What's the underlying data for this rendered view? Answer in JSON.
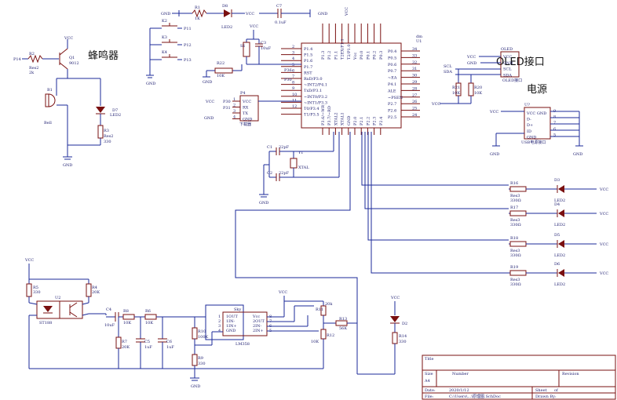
{
  "headings": {
    "buzzer": "蜂鸣器",
    "oled": "OLED接口",
    "power": "电源"
  },
  "nets": {
    "vcc": "VCC",
    "gnd": "GND"
  },
  "mcu": {
    "ref": "U1",
    "left_pins": [
      "P1.4",
      "P1.5",
      "P1.6",
      "P1.7",
      "RST",
      "RxD/P3.0",
      "~INT2/P4.1",
      "TxD/P3.1",
      "~INT0/P3.2",
      "~INT1/P3.3",
      "T0/P3.4",
      "T1/P3.5"
    ],
    "left_nums": [
      "2",
      "3",
      "4",
      "5",
      "6",
      "7",
      "8",
      "9",
      "10",
      "11",
      "12"
    ],
    "right_pins": [
      "P0.4",
      "P0.5",
      "P0.6",
      "P0.7",
      "~EA",
      "P4.1",
      "ALE",
      "~PSEN",
      "P2.7",
      "P2.6",
      "P2.5"
    ],
    "right_nums": [
      "34",
      "33",
      "32",
      "31",
      "30",
      "29",
      "28",
      "27",
      "26",
      "25",
      "24"
    ],
    "top_pins": [
      "P1.3",
      "P1.2",
      "P1.1",
      "T2EX/P1.1",
      "T2/P1.0",
      "Vcc",
      "P0.0",
      "P0.1",
      "P0.2",
      "P0.3"
    ],
    "bottom_pins": [
      "P3.6/~WR",
      "P3.7/~RD",
      "XTAL2",
      "XTAL1",
      "GND",
      "P2.0",
      "P2.1",
      "P2.2",
      "P2.3",
      "P2.4"
    ]
  },
  "parts": {
    "r1": "R1",
    "r1v": "1K",
    "d8": "D8",
    "d8v": "LED2",
    "c7": "C7",
    "c7v": "0.1uF",
    "k2": "K2",
    "k3": "K3",
    "k4": "K4",
    "p11": "P11",
    "p12": "P12",
    "p13": "P13",
    "p14": "P14",
    "r2": "R2",
    "r2t": "Res2",
    "r2v": "2k",
    "q1": "Q1",
    "q1v": "9012",
    "b1": "B1",
    "b1v": "Bell",
    "d7": "D7",
    "d7v": "LED2",
    "r3": "R3",
    "r3t": "Res2",
    "r3v": "330",
    "c3": "C3",
    "c3v": "10uF",
    "s1": "S1",
    "r22": "R22",
    "r22v": "10K",
    "p36": "P36",
    "p30": "P30",
    "p31": "P31",
    "p4": "P4",
    "p4t": "下载器",
    "p4pins": [
      "VCC",
      "RX",
      "TX",
      "GND"
    ],
    "p4nums": [
      "1",
      "2",
      "3",
      "4"
    ],
    "c1": "C1",
    "c1v": "22pF",
    "c2": "C2",
    "c2v": "22pF",
    "y1": "Y1",
    "y1v": "XTAL",
    "scl": "SCL",
    "sda": "SDA",
    "r20": "R20",
    "r20v": "10K",
    "r21": "R21",
    "r21v": "10K",
    "oled": "OLED",
    "oledpins": [
      "VCC",
      "GND",
      "SCL",
      "SDA"
    ],
    "oledt": "OLED接口",
    "usb": "U?",
    "usbpins": [
      "VCC GND",
      "D-",
      "D+",
      "ID",
      "GND"
    ],
    "usbnums": [
      "9",
      "8",
      "7",
      "6",
      "5"
    ],
    "usbt": "USB电源接口",
    "r16": "R16",
    "r17": "R17",
    "r18": "R18",
    "r19": "R19",
    "res3": "Res3",
    "r330": "330Ω",
    "d3": "D3",
    "d4": "D4",
    "d5": "D5",
    "d6": "D6",
    "led2": "LED2",
    "r5": "R5",
    "r5v": "330",
    "r4": "R4",
    "r4v": "20K",
    "u2": "U2",
    "u2v": "ST188",
    "c4": "C4",
    "c4v": "10uF",
    "r8": "R8",
    "r8v": "10K",
    "r6": "R6",
    "r6v": "10K",
    "r7": "R7",
    "r7v": "20K",
    "c5": "C5",
    "c5v": "1uF",
    "c6": "C6",
    "c6v": "1uF",
    "r10": "R10",
    "r10v": "100K",
    "r9": "R9",
    "r9v": "330",
    "lm": "LM358",
    "lmref": "Sky",
    "lm_left": [
      "1OUT",
      "1IN-",
      "1IN+",
      "GND"
    ],
    "lm_right": [
      "Vcc",
      "2OUT",
      "2IN-",
      "2IN+"
    ],
    "lm_lnums": [
      "1",
      "2",
      "3",
      "4"
    ],
    "lm_rnums": [
      "8",
      "7",
      "6",
      "5"
    ],
    "r11": "R11",
    "r11v": "20k",
    "r12": "R12",
    "r12v": "10K",
    "r13": "R13",
    "r13v": "56K",
    "d2": "D2",
    "r14": "R14",
    "r14v": "330"
  },
  "titleblock": {
    "title": "Title",
    "size_label": "Size",
    "size": "A4",
    "number_label": "Number",
    "revision_label": "Revision",
    "date_label": "Date:",
    "date": "2020/1/12",
    "file_label": "File:",
    "file": "C:\\Users\\...\\原理图.SchDoc",
    "sheet_label": "Sheet",
    "of_label": "of",
    "drawnby_label": "Drawn By:"
  }
}
